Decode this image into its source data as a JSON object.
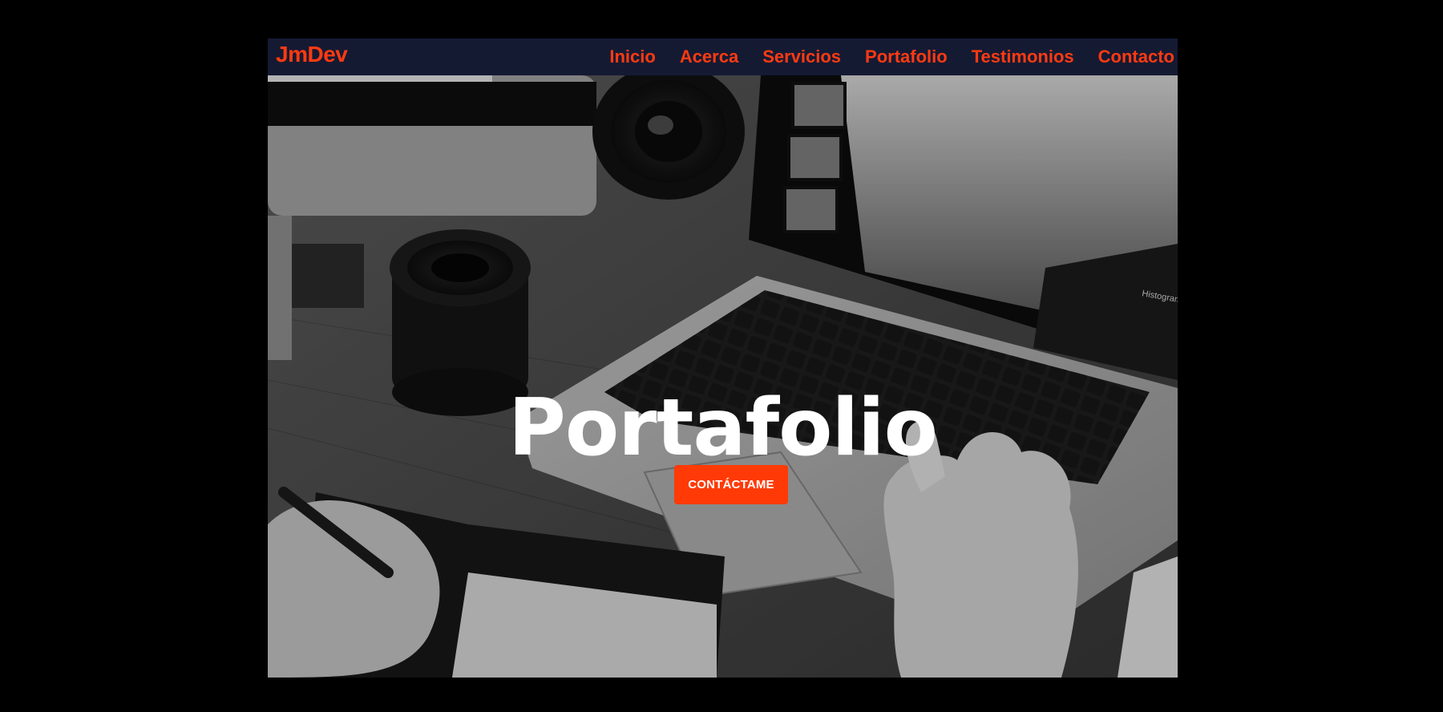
{
  "navbar": {
    "brand": "JmDev",
    "links": [
      "Inicio",
      "Acerca",
      "Servicios",
      "Portafolio",
      "Testimonios",
      "Contacto"
    ]
  },
  "hero": {
    "title": "Portafolio",
    "cta_label": "CONTÁCTAME",
    "laptop_screen_text": "Histogram"
  },
  "colors": {
    "accent": "#ff3a12",
    "navbar_bg": "#151a33",
    "page_bg": "#000000",
    "cta_bg": "#ff3a06",
    "title_color": "#ffffff"
  }
}
